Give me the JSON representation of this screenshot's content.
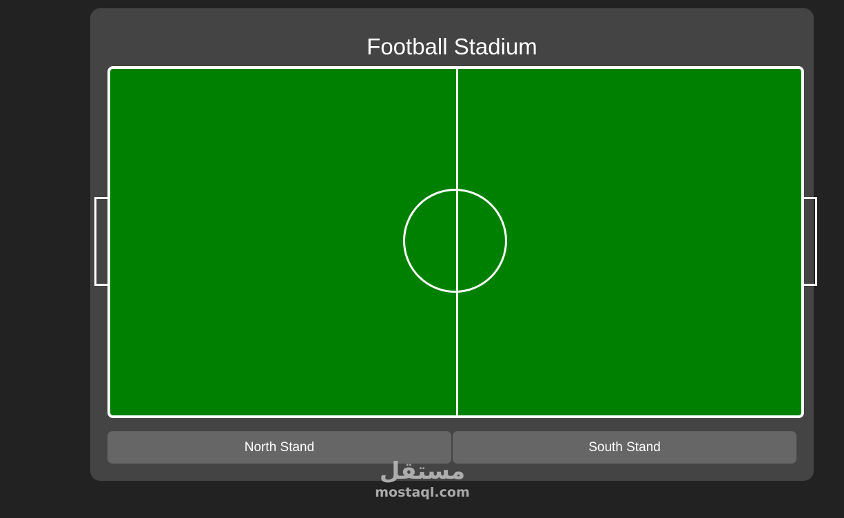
{
  "page": {
    "title": "Football Stadium"
  },
  "pitch": {
    "surface_color": "#008000",
    "line_color": "#ffffff"
  },
  "stands": [
    {
      "label": "North Stand"
    },
    {
      "label": "South Stand"
    }
  ],
  "watermark": {
    "logo_text": "مستقل",
    "domain": "mostaql.com"
  },
  "colors": {
    "background": "#222222",
    "panel": "#444444",
    "stand_button": "#666666"
  }
}
